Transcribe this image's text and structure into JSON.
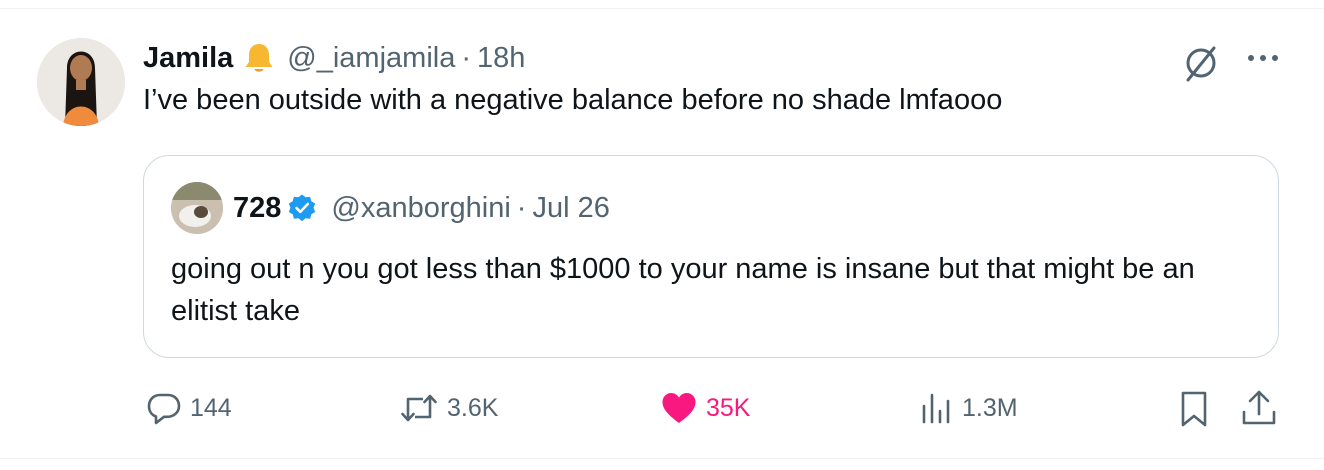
{
  "tweet": {
    "author_name": "Jamila",
    "author_handle": "@_iamjamila",
    "separator": "·",
    "time": "18h",
    "text": "I’ve been outside with a negative balance before no shade lmfaooo"
  },
  "quote": {
    "author_name": "728",
    "author_handle": "@xanborghini",
    "separator": "·",
    "date": "Jul 26",
    "text": "going out n you got less than $1000 to your name is insane but that might be an elitist take"
  },
  "actions": {
    "replies": "144",
    "reposts": "3.6K",
    "likes": "35K",
    "views": "1.3M"
  },
  "icons": {
    "notification": "bell-icon",
    "grok": "grok-icon",
    "more": "more-icon",
    "verified": "verified-badge-icon",
    "reply": "reply-icon",
    "repost": "repost-icon",
    "like": "heart-icon",
    "views": "views-icon",
    "bookmark": "bookmark-icon",
    "share": "share-icon"
  },
  "colors": {
    "text": "#0f1419",
    "secondary": "#536471",
    "like": "#f91880",
    "verified": "#1d9bf0",
    "bell": "#f7b731",
    "border": "#cfd9de"
  }
}
